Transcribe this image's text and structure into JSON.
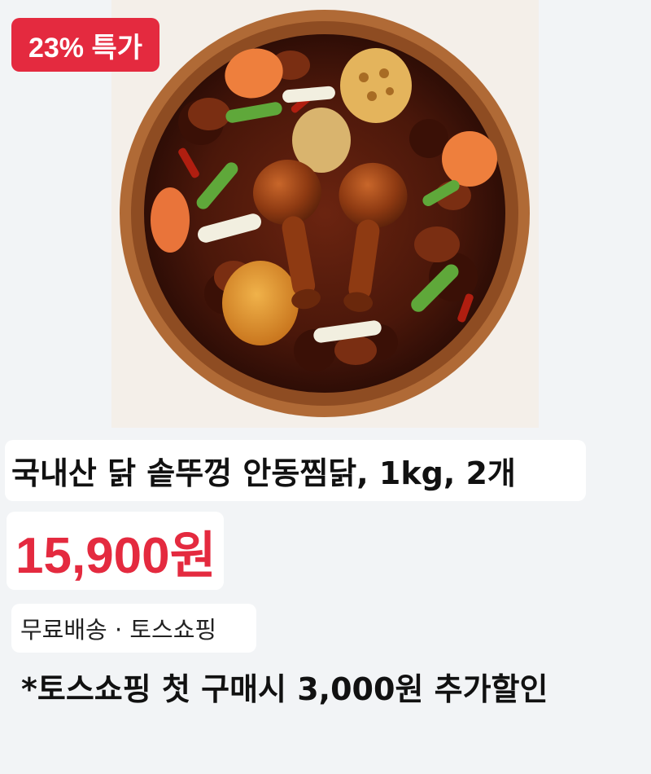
{
  "badge": {
    "label": "23% 특가"
  },
  "product": {
    "image_name": "안동찜닭 product photo",
    "title": "국내산 닭 솥뚜껑 안동찜닭, 1kg, 2개",
    "price": "15,900원",
    "shipping": "무료배송 · 토스쇼핑",
    "promo": "*토스쇼핑 첫 구매시 3,000원 추가할인"
  },
  "colors": {
    "accent": "#e42a3f",
    "background": "#f2f4f6",
    "card": "#ffffff",
    "text": "#111111"
  }
}
